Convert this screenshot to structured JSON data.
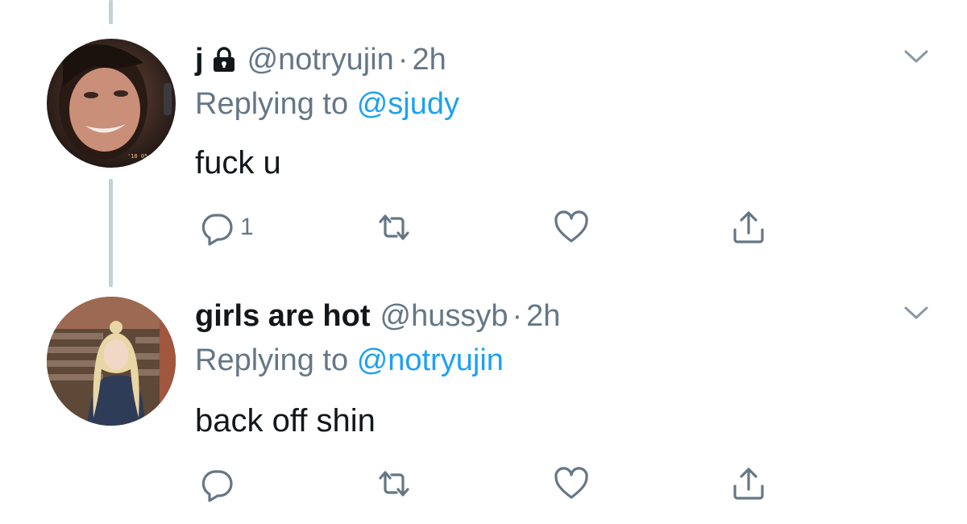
{
  "colors": {
    "text_primary": "#14171a",
    "text_secondary": "#657786",
    "link": "#1da1f2",
    "thread_line": "#c4cfd6"
  },
  "tweets": [
    {
      "display_name": "j",
      "protected": true,
      "handle": "@notryujin",
      "separator": "·",
      "time": "2h",
      "replying_prefix": "Replying to",
      "replying_to": "@sjudy",
      "text": "fuck u",
      "reply_count": "1",
      "icons": [
        "lock-icon",
        "chevron-down-icon",
        "reply-icon",
        "retweet-icon",
        "like-icon",
        "share-icon"
      ]
    },
    {
      "display_name": "girls are hot",
      "protected": false,
      "handle": "@hussyb",
      "separator": "·",
      "time": "2h",
      "replying_prefix": "Replying to",
      "replying_to": "@notryujin",
      "text": "back off shin",
      "reply_count": "",
      "icons": [
        "chevron-down-icon",
        "reply-icon",
        "retweet-icon",
        "like-icon",
        "share-icon"
      ]
    }
  ]
}
